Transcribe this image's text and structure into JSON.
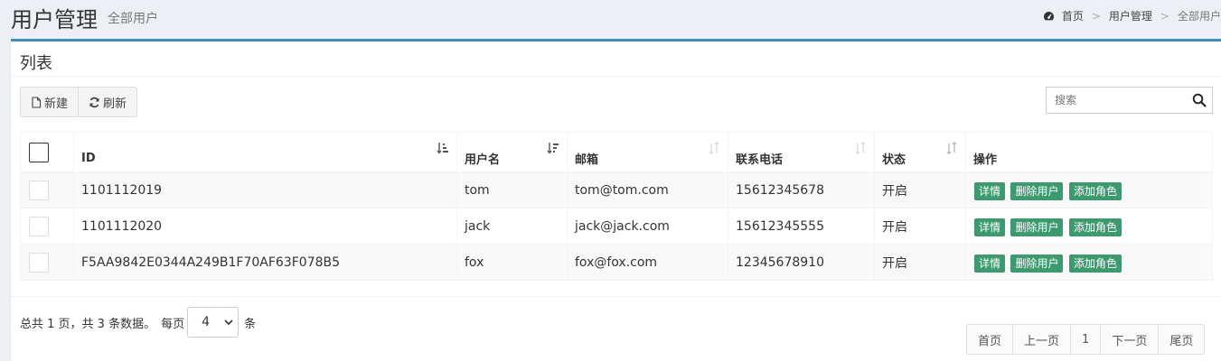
{
  "header": {
    "title": "用户管理",
    "subtitle": "全部用户",
    "breadcrumb": [
      "首页",
      "用户管理",
      "全部用户"
    ]
  },
  "box": {
    "title": "列表",
    "toolbar": {
      "new_label": "新建",
      "refresh_label": "刷新"
    },
    "search": {
      "placeholder": "搜索"
    }
  },
  "table": {
    "columns": [
      "ID",
      "用户名",
      "邮箱",
      "联系电话",
      "状态",
      "操作"
    ],
    "rows": [
      {
        "id": "1101112019",
        "username": "tom",
        "email": "tom@tom.com",
        "phone": "15612345678",
        "status": "开启"
      },
      {
        "id": "1101112020",
        "username": "jack",
        "email": "jack@jack.com",
        "phone": "15612345555",
        "status": "开启"
      },
      {
        "id": "F5AA9842E0344A249B1F70AF63F078B5",
        "username": "fox",
        "email": "fox@fox.com",
        "phone": "12345678910",
        "status": "开启"
      }
    ],
    "actions": {
      "detail": "详情",
      "delete": "删除用户",
      "add_role": "添加角色"
    }
  },
  "footer": {
    "summary": "总共 1 页，共 3 条数据。",
    "per_page_prefix": "每页",
    "per_page_value": "4",
    "per_page_suffix": "条"
  },
  "pagination": {
    "first": "首页",
    "prev": "上一页",
    "current": "1",
    "next": "下一页",
    "last": "尾页"
  },
  "colors": {
    "accent": "#3c8dbc",
    "action_button": "#3d9970",
    "background": "#ecf0f5"
  }
}
